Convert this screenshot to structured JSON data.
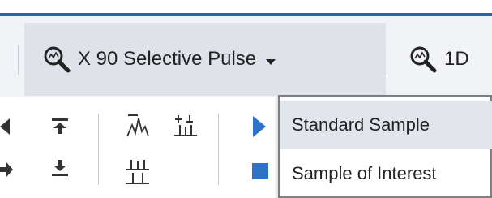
{
  "toolbar": {
    "zoom_button": {
      "label": "X 90 Selective Pulse",
      "icon": "zoom-icon"
    },
    "next_button": {
      "label": "1D",
      "icon": "zoom-icon"
    }
  },
  "tools": [
    {
      "name": "move-left-tool",
      "icon": "arrow-left-icon"
    },
    {
      "name": "move-right-tool",
      "icon": "arrow-right-icon"
    },
    {
      "name": "top-align-tool",
      "icon": "align-top-icon"
    },
    {
      "name": "bottom-align-tool",
      "icon": "align-bottom-icon"
    },
    {
      "name": "peak-tool",
      "icon": "peak-icon"
    },
    {
      "name": "integrate-tool",
      "icon": "integrate-icon"
    },
    {
      "name": "multiplet-tool",
      "icon": "multiplet-icon"
    },
    {
      "name": "play-tool",
      "icon": "play-icon"
    },
    {
      "name": "stop-tool",
      "icon": "stop-icon"
    }
  ],
  "dropdown": {
    "items": [
      {
        "label": "Standard Sample",
        "state": "hover"
      },
      {
        "label": "Sample of Interest",
        "state": "default"
      }
    ]
  },
  "colors": {
    "accent": "#2a63b9",
    "icon_blue": "#2f72c9",
    "menu_hover": "#e2e6ec"
  }
}
